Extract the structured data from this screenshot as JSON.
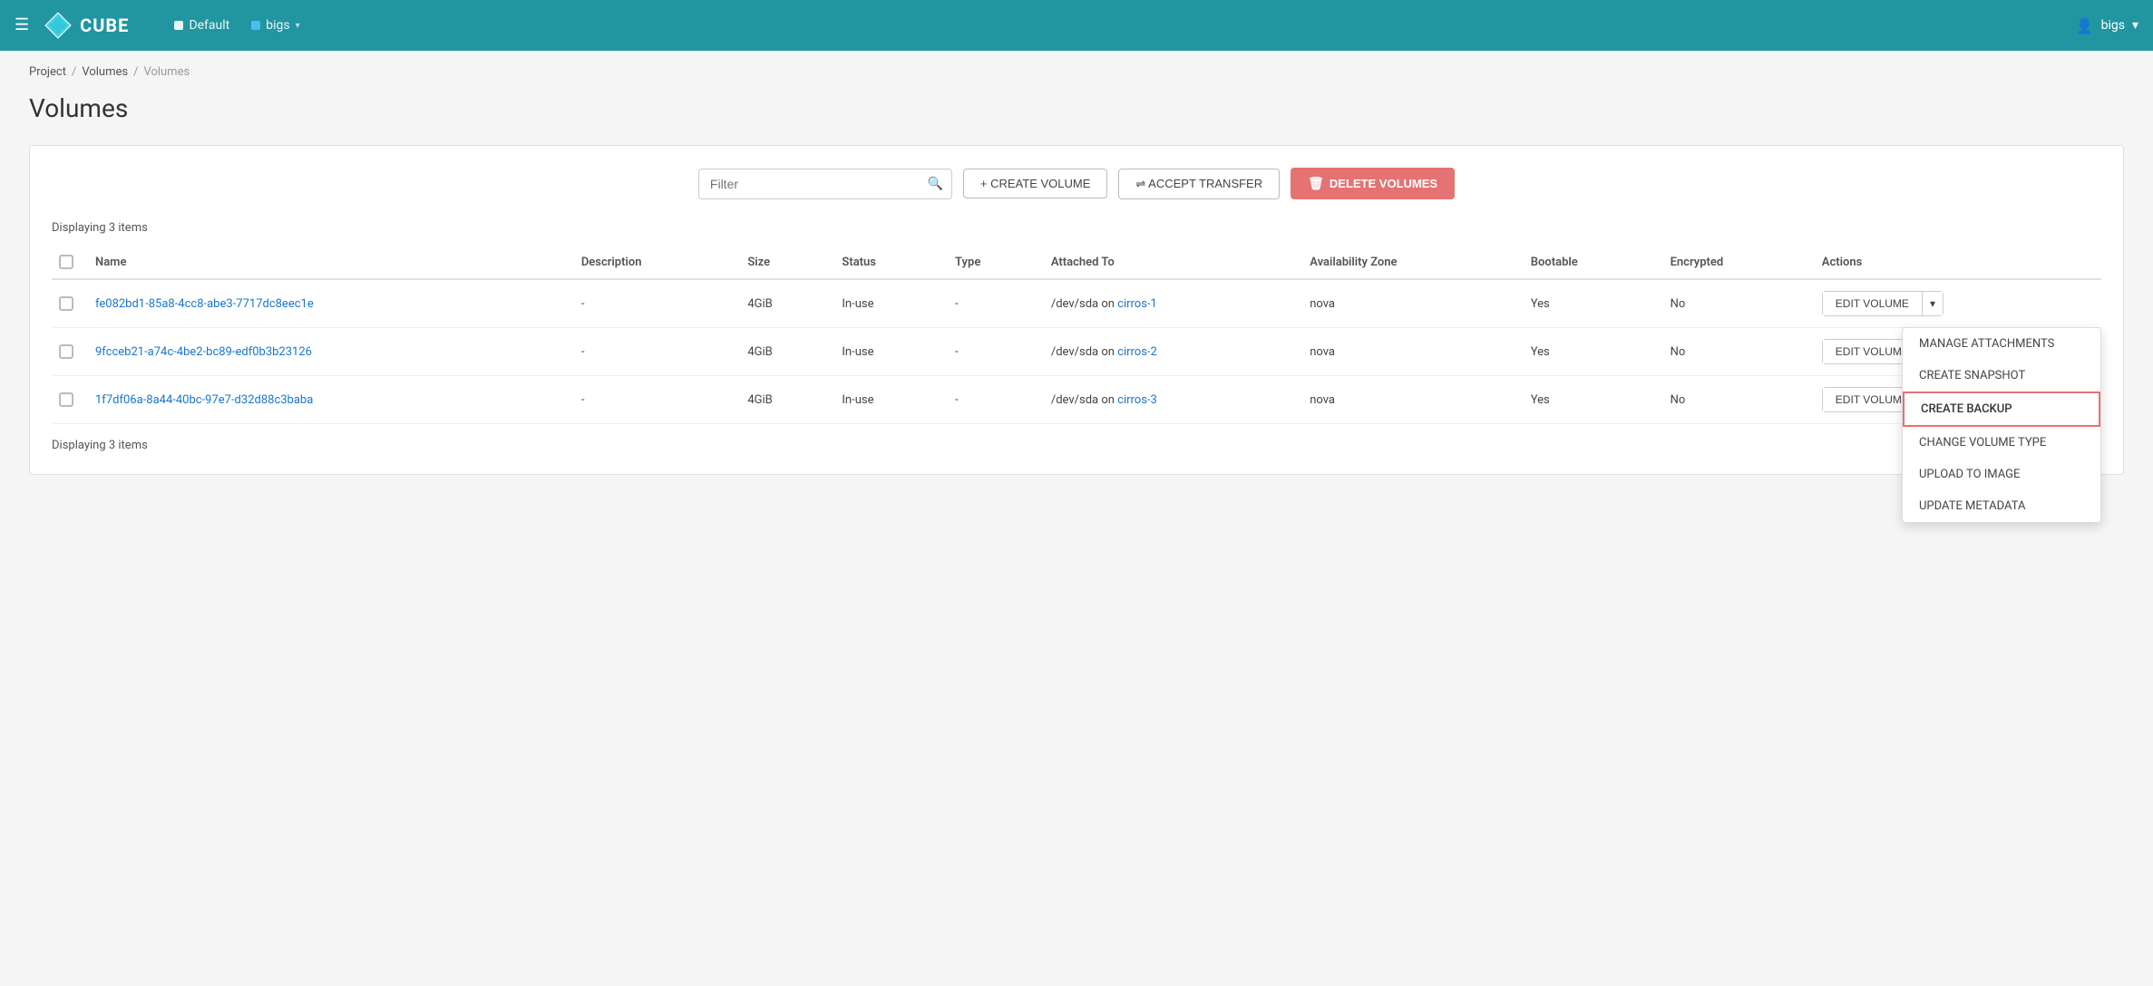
{
  "header": {
    "menu_icon": "☰",
    "logo_text": "CUBE",
    "nav": [
      {
        "id": "default",
        "label": "Default",
        "dot_color": "white"
      },
      {
        "id": "bigs",
        "label": "bigs",
        "dot_color": "blue",
        "has_arrow": true
      }
    ],
    "user_label": "bigs",
    "user_icon": "▼"
  },
  "breadcrumb": {
    "items": [
      "Project",
      "Volumes",
      "Volumes"
    ],
    "separator": "/"
  },
  "page": {
    "title": "Volumes"
  },
  "toolbar": {
    "filter_placeholder": "Filter",
    "filter_search_icon": "🔍",
    "create_volume_label": "+ CREATE VOLUME",
    "accept_transfer_label": "⇌ ACCEPT TRANSFER",
    "delete_volumes_label": "DELETE VOLUMES",
    "delete_icon": "🗑"
  },
  "table": {
    "displaying_text_top": "Displaying 3 items",
    "displaying_text_bottom": "Displaying 3 items",
    "columns": [
      "Name",
      "Description",
      "Size",
      "Status",
      "Type",
      "Attached To",
      "Availability Zone",
      "Bootable",
      "Encrypted",
      "Actions"
    ],
    "rows": [
      {
        "name": "fe082bd1-85a8-4cc8-abe3-7717dc8eec1e",
        "description": "-",
        "size": "4GiB",
        "status": "In-use",
        "type": "-",
        "attached_to_prefix": "/dev/sda on ",
        "attached_to_link": "cirros-1",
        "availability_zone": "nova",
        "bootable": "Yes",
        "encrypted": "No",
        "action_main": "EDIT VOLUME",
        "show_dropdown": true
      },
      {
        "name": "9fcceb21-a74c-4be2-bc89-edf0b3b23126",
        "description": "-",
        "size": "4GiB",
        "status": "In-use",
        "type": "-",
        "attached_to_prefix": "/dev/sda on ",
        "attached_to_link": "cirros-2",
        "availability_zone": "nova",
        "bootable": "Yes",
        "encrypted": "No",
        "action_main": "EDIT VOLUME",
        "show_dropdown": false
      },
      {
        "name": "1f7df06a-8a44-40bc-97e7-d32d88c3baba",
        "description": "-",
        "size": "4GiB",
        "status": "In-use",
        "type": "-",
        "attached_to_prefix": "/dev/sda on ",
        "attached_to_link": "cirros-3",
        "availability_zone": "nova",
        "bootable": "Yes",
        "encrypted": "No",
        "action_main": "EDIT VOLUME",
        "show_dropdown": false
      }
    ],
    "dropdown_items": [
      {
        "label": "MANAGE ATTACHMENTS",
        "highlighted": false
      },
      {
        "label": "CREATE SNAPSHOT",
        "highlighted": false
      },
      {
        "label": "CREATE BACKUP",
        "highlighted": true
      },
      {
        "label": "CHANGE VOLUME TYPE",
        "highlighted": false
      },
      {
        "label": "UPLOAD TO IMAGE",
        "highlighted": false
      },
      {
        "label": "UPDATE METADATA",
        "highlighted": false
      }
    ]
  }
}
